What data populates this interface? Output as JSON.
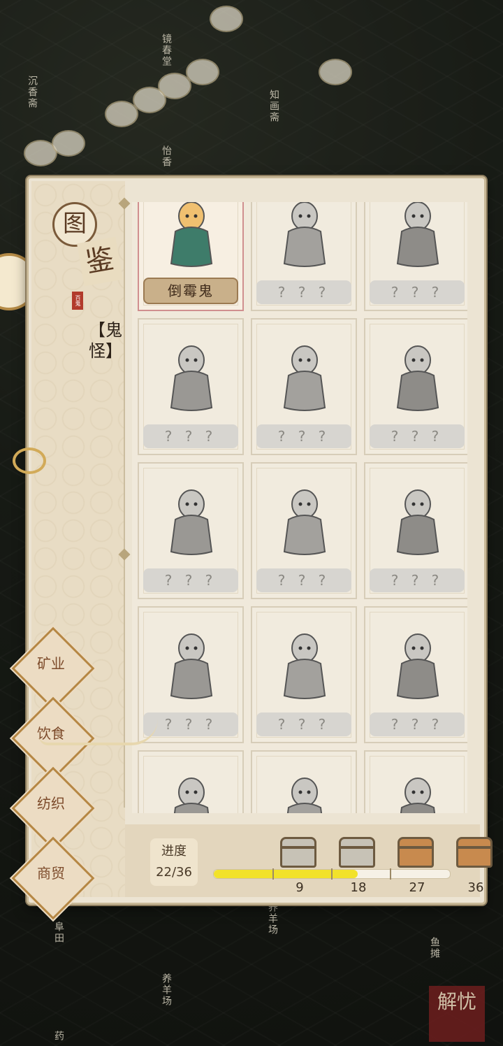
{
  "map_labels": [
    "沉香斋",
    "镜春堂",
    "知画斋",
    "怡香",
    "阜田",
    "养羊场",
    "养羊场",
    "鱼摊",
    "药"
  ],
  "seal_text": "解忧",
  "panel": {
    "title_top": "图",
    "title_bottom": "鉴",
    "stamp": "百鬼",
    "category": "【鬼怪】"
  },
  "nav": [
    {
      "label": "矿业"
    },
    {
      "label": "饮食"
    },
    {
      "label": "纺织"
    },
    {
      "label": "商贸"
    }
  ],
  "cards": [
    {
      "label": "倒霉鬼",
      "unlocked": true,
      "icon": "old-man-umbrella-icon"
    },
    {
      "label": "? ? ?",
      "unlocked": false,
      "icon": "ghost-snail-icon"
    },
    {
      "label": "? ? ?",
      "unlocked": false,
      "icon": "hooded-ghost-icon"
    },
    {
      "label": "? ? ?",
      "unlocked": false,
      "icon": "hanged-ghost-icon"
    },
    {
      "label": "? ? ?",
      "unlocked": false,
      "icon": "board-ghost-icon"
    },
    {
      "label": "? ? ?",
      "unlocked": false,
      "icon": "fan-dancer-icon"
    },
    {
      "label": "? ? ?",
      "unlocked": false,
      "icon": "staff-ghost-icon"
    },
    {
      "label": "? ? ?",
      "unlocked": false,
      "icon": "monk-icon"
    },
    {
      "label": "? ? ?",
      "unlocked": false,
      "icon": "squirrel-icon"
    },
    {
      "label": "? ? ?",
      "unlocked": false,
      "icon": "sea-goddess-icon"
    },
    {
      "label": "? ? ?",
      "unlocked": false,
      "icon": "lady-ghost-icon"
    },
    {
      "label": "? ? ?",
      "unlocked": false,
      "icon": "farmer-icon"
    },
    {
      "label": "",
      "unlocked": false,
      "icon": "rabbit-icon"
    },
    {
      "label": "",
      "unlocked": false,
      "icon": "firework-icon"
    },
    {
      "label": "",
      "unlocked": false,
      "icon": "official-icon"
    }
  ],
  "progress": {
    "title": "进度",
    "count": "22/36",
    "fraction": 0.61,
    "milestones": [
      "9",
      "18",
      "27",
      "36"
    ],
    "chests": [
      "open",
      "open",
      "closed",
      "closed"
    ]
  },
  "colors": {
    "progress_fill": "#f2e22a",
    "accent": "#b68744"
  }
}
